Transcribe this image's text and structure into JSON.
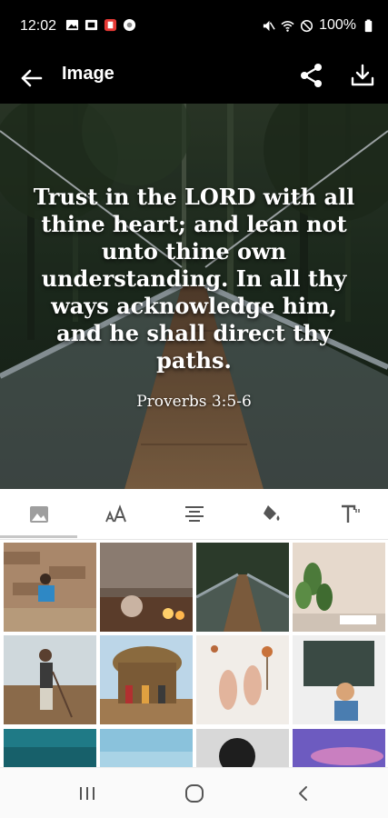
{
  "status": {
    "time": "12:02",
    "battery": "100%",
    "left_icons": [
      "image-notification-icon",
      "gallery-notification-icon",
      "app-notification-icon",
      "misc-notification-icon"
    ],
    "right_icons": [
      "mute-icon",
      "wifi-icon",
      "do-not-disturb-icon",
      "battery-icon"
    ]
  },
  "app_bar": {
    "title": "Image",
    "back_icon": "arrow-left-icon",
    "share_icon": "share-icon",
    "download_icon": "download-icon"
  },
  "preview": {
    "quote": "Trust in the LORD with all thine heart; and lean not unto thine own understanding. In all thy ways acknowledge him, and he shall direct thy paths.",
    "reference": "Proverbs 3:5-6",
    "background": "suspension bridge in forest"
  },
  "toolbar": {
    "tools": [
      "background-image-icon",
      "font-size-icon",
      "align-center-icon",
      "fill-color-icon",
      "text-style-icon"
    ],
    "selected_index": 0
  },
  "thumbnails": [
    "girl on swing by stone wall",
    "cup and candles on table",
    "suspension bridge in forest",
    "plant and open book",
    "farmer with hoe in field",
    "people at thatched hut",
    "hands with dried flowers",
    "child at chalkboard",
    "teal water",
    "blue sky",
    "person portrait",
    "purple sunset sky"
  ],
  "colors": {
    "bar_bg": "#000000",
    "toolbar_bg": "#ffffff",
    "accent": "#c7c7c7"
  }
}
